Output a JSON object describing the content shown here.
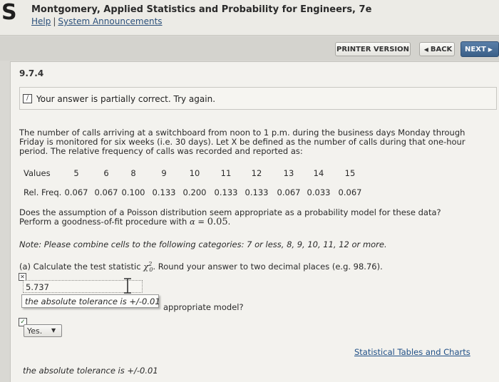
{
  "header": {
    "logo": "S",
    "title": "Montgomery, Applied Statistics and Probability for Engineers, 7e",
    "help_link": "Help",
    "separator": "|",
    "announcements_link": "System Announcements"
  },
  "toolbar": {
    "printer_label": "PRINTER VERSION",
    "back_label": "BACK",
    "next_label": "NEXT"
  },
  "problem": {
    "id": "9.7.4",
    "status": "Your answer is partially correct.  Try again.",
    "intro": "The number of calls arriving at a switchboard from noon to 1 p.m. during the business days Monday through Friday is monitored for six weeks (i.e. 30 days). Let X be defined as the number of calls during that one-hour period. The relative frequency of calls was recorded and reported as:",
    "table": {
      "values_label": "Values",
      "freq_label": "Rel. Freq.",
      "values": [
        "5",
        "6",
        "8",
        "9",
        "10",
        "11",
        "12",
        "13",
        "14",
        "15"
      ],
      "freqs": [
        "0.067",
        "0.067",
        "0.100",
        "0.133",
        "0.200",
        "0.133",
        "0.133",
        "0.067",
        "0.033",
        "0.067"
      ]
    },
    "question_line1": "Does the assumption of a Poisson distribution seem appropriate as a probability model for these data?",
    "question_line2_prefix": "Perform a goodness-of-fit procedure with",
    "alpha_symbol": "α",
    "equals": " = ",
    "alpha_value": "0.05",
    "period": ".",
    "note": "Note: Please combine cells to the following categories: 7 or less, 8, 9, 10, 11, 12 or more.",
    "parta_prefix": "(a) Calculate the test statistic",
    "chi_symbol": "χ",
    "chi_sup": "2",
    "chi_sub": "0",
    "parta_suffix": ". Round your answer to two decimal places (e.g. 98.76).",
    "answer_value": "5.737",
    "tolerance_tooltip": "the absolute tolerance is +/-0.01",
    "model_fragment": "appropriate model?",
    "select_value": "Yes.",
    "tables_link": "Statistical Tables and Charts",
    "tolerance_text": "the absolute tolerance is +/-0.01"
  }
}
